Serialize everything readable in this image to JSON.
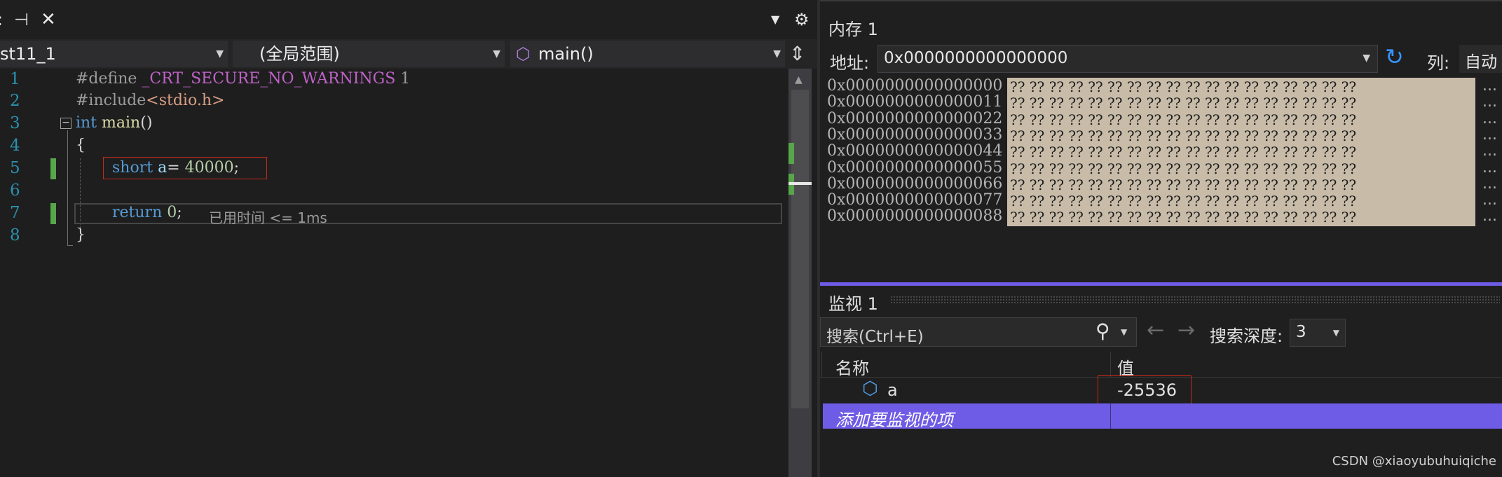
{
  "editor": {
    "tab_icons": [
      "pin-icon",
      "close-icon"
    ],
    "project_combo": "st11_1",
    "scope_combo": "(全局范围)",
    "function_combo": "main()",
    "lines": [
      {
        "num": "1",
        "tokens": [
          {
            "t": "#define ",
            "c": "pp"
          },
          {
            "t": "_CRT_SECURE_NO_WARNINGS",
            "c": "macro"
          },
          {
            "t": " 1",
            "c": "pp"
          }
        ]
      },
      {
        "num": "2",
        "tokens": [
          {
            "t": "#include",
            "c": "pp"
          },
          {
            "t": "<stdio.h>",
            "c": "str"
          }
        ]
      },
      {
        "num": "3",
        "tokens": [
          {
            "t": "int",
            "c": "kw"
          },
          {
            "t": " ",
            "c": "plain"
          },
          {
            "t": "main",
            "c": "fn"
          },
          {
            "t": "()",
            "c": "plain"
          }
        ]
      },
      {
        "num": "4",
        "tokens": [
          {
            "t": "{",
            "c": "plain"
          }
        ]
      },
      {
        "num": "5",
        "tokens": [
          {
            "t": "short",
            "c": "kw"
          },
          {
            "t": " ",
            "c": "plain"
          },
          {
            "t": "a",
            "c": "var"
          },
          {
            "t": "= ",
            "c": "plain"
          },
          {
            "t": "40000",
            "c": "num"
          },
          {
            "t": ";",
            "c": "plain"
          }
        ]
      },
      {
        "num": "6",
        "tokens": []
      },
      {
        "num": "7",
        "tokens": [
          {
            "t": "return",
            "c": "kw"
          },
          {
            "t": " ",
            "c": "plain"
          },
          {
            "t": "0",
            "c": "num"
          },
          {
            "t": ";",
            "c": "plain"
          }
        ]
      },
      {
        "num": "8",
        "tokens": [
          {
            "t": "}",
            "c": "plain"
          }
        ]
      }
    ],
    "elapsed_hint": "已用时间 <= 1ms"
  },
  "memory": {
    "title": "内存 1",
    "address_label": "地址:",
    "address_value": "0x0000000000000000",
    "columns_label": "列:",
    "columns_value": "自动",
    "rows": [
      {
        "addr": "0x0000000000000000",
        "bytes": "?? ?? ?? ?? ?? ?? ?? ?? ?? ?? ?? ?? ?? ?? ?? ?? ?? ??",
        "tail": "..."
      },
      {
        "addr": "0x0000000000000011",
        "bytes": "?? ?? ?? ?? ?? ?? ?? ?? ?? ?? ?? ?? ?? ?? ?? ?? ?? ??",
        "tail": "..."
      },
      {
        "addr": "0x0000000000000022",
        "bytes": "?? ?? ?? ?? ?? ?? ?? ?? ?? ?? ?? ?? ?? ?? ?? ?? ?? ??",
        "tail": "..."
      },
      {
        "addr": "0x0000000000000033",
        "bytes": "?? ?? ?? ?? ?? ?? ?? ?? ?? ?? ?? ?? ?? ?? ?? ?? ?? ??",
        "tail": "..."
      },
      {
        "addr": "0x0000000000000044",
        "bytes": "?? ?? ?? ?? ?? ?? ?? ?? ?? ?? ?? ?? ?? ?? ?? ?? ?? ??",
        "tail": "..."
      },
      {
        "addr": "0x0000000000000055",
        "bytes": "?? ?? ?? ?? ?? ?? ?? ?? ?? ?? ?? ?? ?? ?? ?? ?? ?? ??",
        "tail": "..."
      },
      {
        "addr": "0x0000000000000066",
        "bytes": "?? ?? ?? ?? ?? ?? ?? ?? ?? ?? ?? ?? ?? ?? ?? ?? ?? ??",
        "tail": "..."
      },
      {
        "addr": "0x0000000000000077",
        "bytes": "?? ?? ?? ?? ?? ?? ?? ?? ?? ?? ?? ?? ?? ?? ?? ?? ?? ??",
        "tail": "..."
      },
      {
        "addr": "0x0000000000000088",
        "bytes": "?? ?? ?? ?? ?? ?? ?? ?? ?? ?? ?? ?? ?? ?? ?? ?? ?? ??",
        "tail": "..."
      }
    ]
  },
  "watch": {
    "title": "监视 1",
    "search_placeholder": "搜索(Ctrl+E)",
    "depth_label": "搜索深度:",
    "depth_value": "3",
    "col_name": "名称",
    "col_value": "值",
    "rows": [
      {
        "name": "a",
        "value": "-25536"
      }
    ],
    "add_item": "添加要监视的项"
  },
  "footer": {
    "watermark": "CSDN @xiaoyubuhuiqiche"
  },
  "colors": {
    "accent": "#6e5ce6",
    "highlight_box": "#c42b1c",
    "memory_bg": "#c8bca9",
    "line_number": "#2b91af",
    "keyword": "#569cd6",
    "number": "#b5cea8"
  }
}
